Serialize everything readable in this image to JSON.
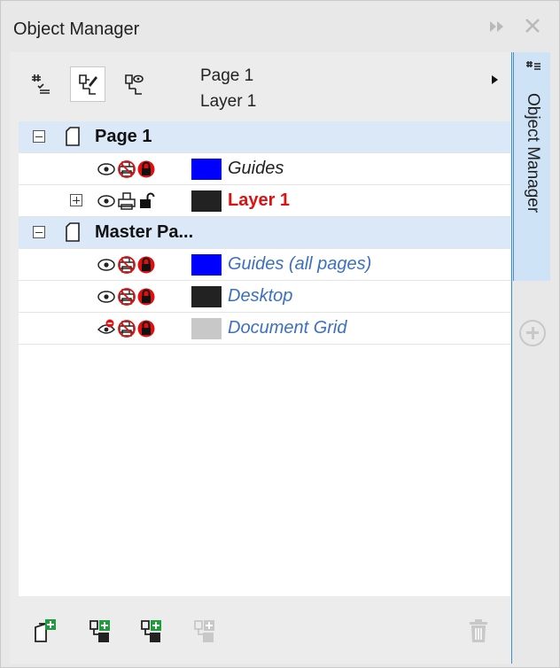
{
  "window": {
    "title": "Object Manager",
    "expand_icon": "double-chevron-right-icon",
    "close_icon": "close-icon"
  },
  "toolbar": {
    "buttons": [
      {
        "name": "show-object-properties-icon",
        "active": false
      },
      {
        "name": "edit-across-layers-icon",
        "active": true
      },
      {
        "name": "layer-manager-view-icon",
        "active": false
      }
    ],
    "breadcrumb": {
      "page": "Page 1",
      "layer": "Layer 1"
    },
    "menu_arrow_icon": "triangle-right-icon"
  },
  "tree": {
    "rows": [
      {
        "type": "page",
        "label": "Page 1",
        "expanded": true
      },
      {
        "type": "layer",
        "label": "Guides",
        "style": "italic",
        "color": "#0000ff",
        "visible": true,
        "printable": false,
        "locked": true
      },
      {
        "type": "layer",
        "label": "Layer 1",
        "style": "red-bold",
        "color": "#222222",
        "visible": true,
        "printable": true,
        "locked": false,
        "has_children": true
      },
      {
        "type": "page",
        "label": "Master Pa...",
        "expanded": true
      },
      {
        "type": "layer",
        "label": "Guides (all pages)",
        "style": "blue-italic",
        "color": "#0000ff",
        "visible": true,
        "printable": false,
        "locked": true
      },
      {
        "type": "layer",
        "label": "Desktop",
        "style": "blue-italic",
        "color": "#222222",
        "visible": true,
        "printable": false,
        "locked": true
      },
      {
        "type": "layer",
        "label": "Document Grid",
        "style": "blue-italic",
        "color": "#c8c8c8",
        "visible": false,
        "printable": false,
        "locked": true
      }
    ]
  },
  "bottombar": {
    "buttons": [
      {
        "name": "new-master-page-icon",
        "enabled": true
      },
      {
        "name": "new-layer-icon",
        "enabled": true
      },
      {
        "name": "new-master-layer-icon",
        "enabled": true
      },
      {
        "name": "new-master-layer-all-pages-icon",
        "enabled": false
      },
      {
        "name": "delete-icon",
        "enabled": false
      }
    ]
  },
  "docker": {
    "tab_label": "Object Manager",
    "tab_icon": "object-manager-icon",
    "add_icon": "plus-circle-icon"
  },
  "colors": {
    "accent": "#3a8fd9",
    "page_row_bg": "#dae8f8",
    "active_layer_text": "#e01010",
    "master_layer_text": "#3b6fc4"
  }
}
